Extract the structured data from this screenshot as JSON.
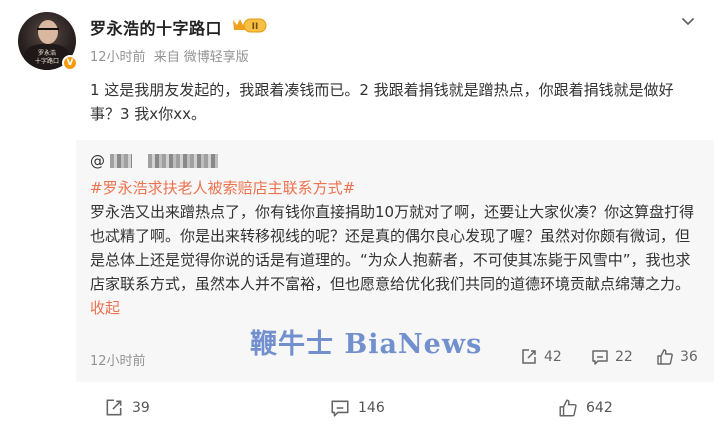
{
  "user": {
    "name": "罗永浩的十字路口",
    "avatar_caption_line1": "罗永浩",
    "avatar_caption_line2": "十字路口",
    "level_badge": "II",
    "verified_badge": "V"
  },
  "meta": {
    "time": "12小时前",
    "source_prefix": "来自",
    "source": "微博轻享版"
  },
  "post": {
    "text": "1 这是我朋友发起的，我跟着凑钱而已。2 我跟着捐钱就是蹭热点，你跟着捐钱就是做好事？3 我x你xx。"
  },
  "quoted": {
    "at": "@",
    "hashtag": "#罗永浩求扶老人被索赔店主联系方式#",
    "body": "罗永浩又出来蹭热点了，你有钱你直接捐助10万就对了啊，还要让大家伙凑？你这算盘打得也忒精了啊。你是出来转移视线的呢？还是真的偶尔良心发现了喔？虽然对你颇有微词，但是总体上还是觉得你说的话是有道理的。“为众人抱薪者，不可使其冻毙于风雪中”，我也求店家联系方式，虽然本人并不富裕，但也愿意给优化我们共同的道德环境贡献点绵薄之力。",
    "collapse_label": "收起",
    "time": "12小时前",
    "reposts": "42",
    "comments": "22",
    "likes": "36"
  },
  "watermark": "鞭牛士 BiaNews",
  "actions": {
    "reposts": "39",
    "comments": "146",
    "likes": "642"
  },
  "colors": {
    "accent": "#eb7350",
    "muted": "#939393",
    "quote_bg": "#f7f7f7",
    "watermark": "#5b7fc8",
    "crown": "#f0a020"
  },
  "icons": {
    "repost": "repost-icon",
    "comment": "comment-icon",
    "like": "thumb-up-icon",
    "more": "chevron-down-icon",
    "crown": "crown-badge-icon"
  }
}
